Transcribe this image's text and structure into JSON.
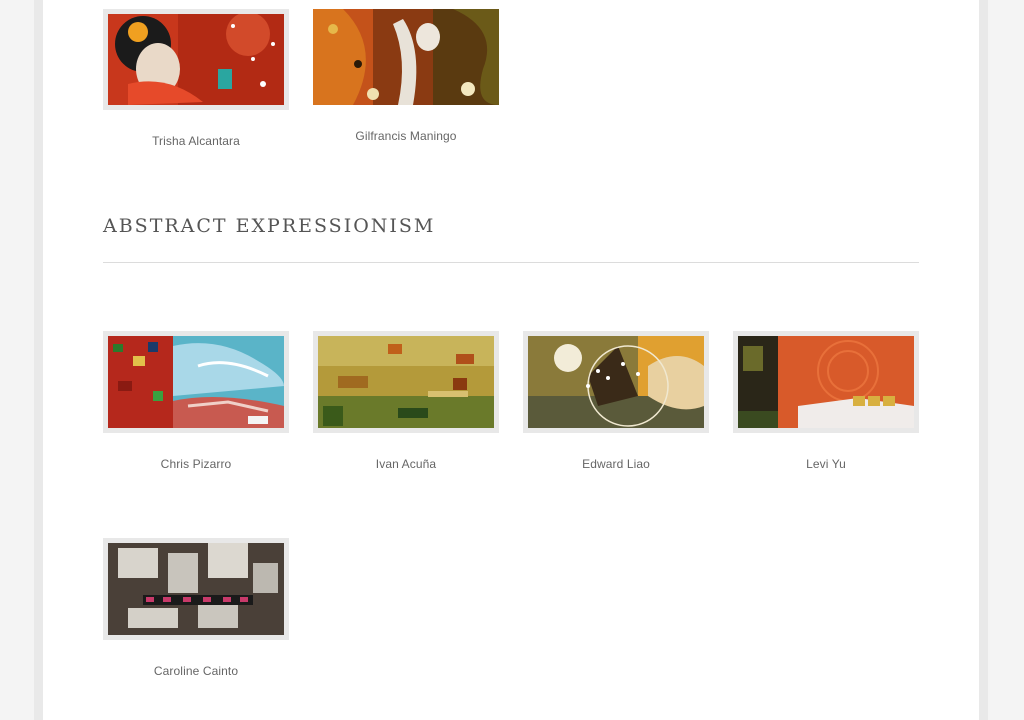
{
  "top_row": [
    {
      "name": "Trisha Alcantara"
    },
    {
      "name": "Gilfrancis Maningo"
    }
  ],
  "section": {
    "title": "ABSTRACT EXPRESSIONISM"
  },
  "abstract_row1": [
    {
      "name": "Chris Pizarro"
    },
    {
      "name": "Ivan Acuña"
    },
    {
      "name": "Edward Liao"
    },
    {
      "name": "Levi Yu"
    }
  ],
  "abstract_row2": [
    {
      "name": "Caroline Cainto"
    }
  ]
}
